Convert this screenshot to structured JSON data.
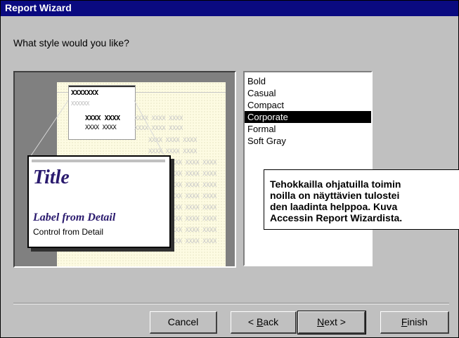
{
  "window": {
    "title": "Report Wizard"
  },
  "prompt": "What style would you like?",
  "preview": {
    "card_heading": "XXXXXXX",
    "card_sub": "XXXXXX",
    "row1_bold": "XXXX XXXX",
    "row1_light": "XXXX XXXX XXXX",
    "row2_bold": "XXXX XXXX",
    "row2_light": "XXXX XXXX XXXX",
    "detail_pattern": "XXXX XXXX XXXX",
    "zoom_title": "Title",
    "zoom_label": "Label from Detail",
    "zoom_control": "Control from Detail"
  },
  "styles": {
    "items": [
      "Bold",
      "Casual",
      "Compact",
      "Corporate",
      "Formal",
      "Soft Gray"
    ],
    "selected": "Corporate"
  },
  "caption": {
    "lines": [
      "Tehokkailla ohjatuilla toimin",
      "noilla on näyttävien tulostei",
      "den laadinta helppoa. Kuva",
      "Accessin Report Wizardista."
    ]
  },
  "buttons": {
    "cancel": "Cancel",
    "back_prefix": "< ",
    "back_key": "B",
    "back_rest": "ack",
    "next_key": "N",
    "next_rest": "ext >",
    "finish_key": "F",
    "finish_rest": "inish"
  }
}
